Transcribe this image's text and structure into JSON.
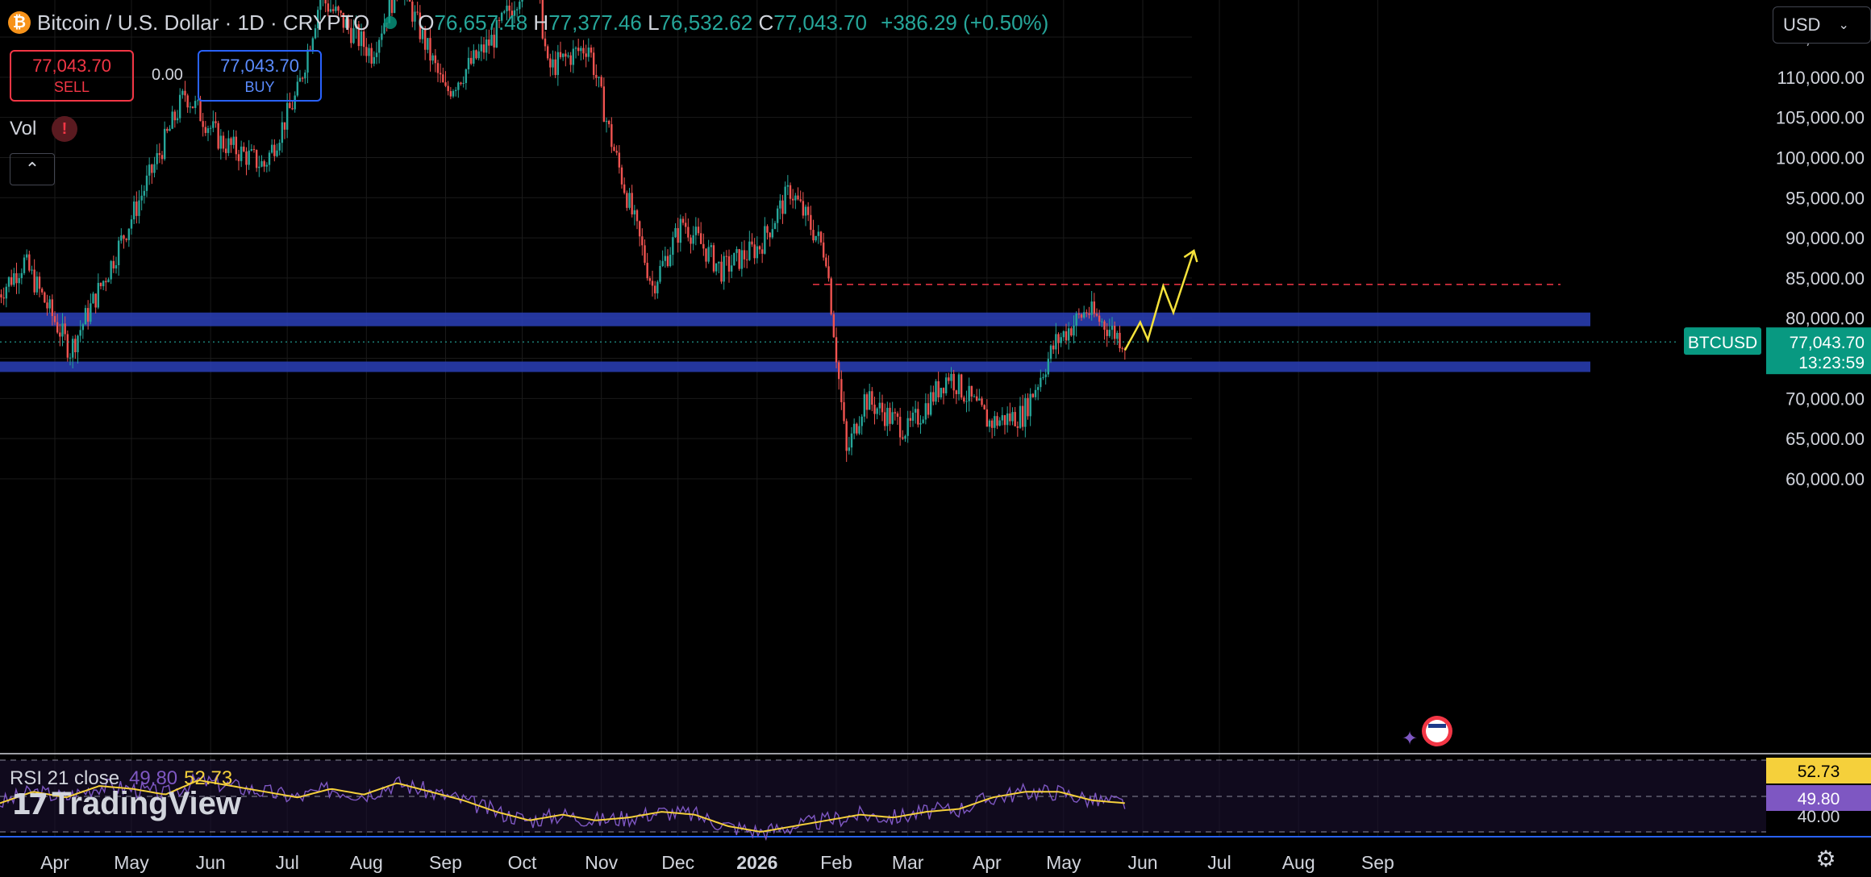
{
  "header": {
    "coin_letter": "₿",
    "symbol_title": "Bitcoin / U.S. Dollar · 1D · CRYPTO",
    "open_label": "O",
    "open_value": "76,657.48",
    "high_label": "H",
    "high_value": "77,377.46",
    "low_label": "L",
    "low_value": "76,532.62",
    "close_label": "C",
    "close_value": "77,043.70",
    "change": "+386.29 (+0.50%)"
  },
  "trade": {
    "sell_price": "77,043.70",
    "sell_label": "SELL",
    "spread": "0.00",
    "buy_price": "77,043.70",
    "buy_label": "BUY"
  },
  "indicators": {
    "vol_label": "Vol",
    "warn_glyph": "!",
    "collapse_glyph": "⌃",
    "rsi_label": "RSI 21 close",
    "rsi_value": "49.80",
    "rsi_ma_value": "52.73"
  },
  "currency_select": "USD",
  "branding": "TradingView",
  "colors": {
    "up": "#26a69a",
    "down": "#ef5350",
    "zone": "#2a3fb8",
    "projection": "#f5e23b",
    "resistance_line": "#f23645",
    "rsi": "#7e57c2",
    "rsi_ma": "#f5d03b"
  },
  "chart_data": {
    "type": "candlestick",
    "title": "Bitcoin / U.S. Dollar · 1D · CRYPTO",
    "ylim": [
      57000,
      118000
    ],
    "y_ticks": [
      60000,
      65000,
      70000,
      75000,
      80000,
      85000,
      90000,
      95000,
      100000,
      105000,
      110000,
      115000
    ],
    "y_tick_labels": [
      "60,000.00",
      "65,000.00",
      "70,000.00",
      "",
      "80,000.00",
      "85,000.00",
      "90,000.00",
      "95,000.00",
      "100,000.00",
      "105,000.00",
      "110,000.00",
      "115,000.00"
    ],
    "x_labels": [
      "Apr",
      "May",
      "Jun",
      "Jul",
      "Aug",
      "Sep",
      "Oct",
      "Nov",
      "Dec",
      "2026",
      "Feb",
      "Mar",
      "Apr",
      "May",
      "Jun",
      "Jul",
      "Aug",
      "Sep"
    ],
    "price_path": [
      {
        "date": "2025-03-10",
        "price": 83000
      },
      {
        "date": "2025-03-20",
        "price": 87000
      },
      {
        "date": "2025-04-07",
        "price": 76000
      },
      {
        "date": "2025-04-22",
        "price": 86000
      },
      {
        "date": "2025-05-10",
        "price": 99000
      },
      {
        "date": "2025-05-22",
        "price": 108000
      },
      {
        "date": "2025-06-05",
        "price": 102000
      },
      {
        "date": "2025-06-22",
        "price": 99000
      },
      {
        "date": "2025-07-05",
        "price": 108000
      },
      {
        "date": "2025-07-14",
        "price": 120000
      },
      {
        "date": "2025-08-03",
        "price": 113000
      },
      {
        "date": "2025-08-14",
        "price": 122000
      },
      {
        "date": "2025-09-01",
        "price": 108000
      },
      {
        "date": "2025-09-20",
        "price": 115000
      },
      {
        "date": "2025-10-06",
        "price": 124000
      },
      {
        "date": "2025-10-11",
        "price": 111000
      },
      {
        "date": "2025-10-27",
        "price": 114000
      },
      {
        "date": "2025-11-05",
        "price": 102000
      },
      {
        "date": "2025-11-21",
        "price": 84000
      },
      {
        "date": "2025-12-03",
        "price": 92000
      },
      {
        "date": "2025-12-18",
        "price": 86000
      },
      {
        "date": "2026-01-02",
        "price": 89000
      },
      {
        "date": "2026-01-14",
        "price": 96000
      },
      {
        "date": "2026-01-28",
        "price": 88000
      },
      {
        "date": "2026-02-05",
        "price": 63000
      },
      {
        "date": "2026-02-12",
        "price": 70000
      },
      {
        "date": "2026-03-01",
        "price": 66000
      },
      {
        "date": "2026-03-17",
        "price": 73000
      },
      {
        "date": "2026-04-02",
        "price": 67000
      },
      {
        "date": "2026-04-15",
        "price": 68000
      },
      {
        "date": "2026-04-28",
        "price": 77000
      },
      {
        "date": "2026-05-10",
        "price": 81000
      },
      {
        "date": "2026-05-18",
        "price": 79000
      },
      {
        "date": "2026-05-25",
        "price": 77000
      }
    ],
    "support_zones": [
      {
        "low": 79000,
        "high": 80700
      },
      {
        "low": 73300,
        "high": 74600
      }
    ],
    "resistance_level": 84200,
    "projection_path": [
      {
        "date": "2026-05-25",
        "price": 76000
      },
      {
        "date": "2026-05-31",
        "price": 79500
      },
      {
        "date": "2026-06-03",
        "price": 77300
      },
      {
        "date": "2026-06-09",
        "price": 84000
      },
      {
        "date": "2026-06-13",
        "price": 80700
      },
      {
        "date": "2026-06-21",
        "price": 88400
      }
    ],
    "last_price": {
      "symbol": "BTCUSD",
      "price": 77043.7,
      "price_label": "77,043.70",
      "countdown": "13:23:59"
    },
    "rsi": {
      "label": "RSI 21 close",
      "ylim": [
        36,
        58
      ],
      "tick_labels": [
        "40.00"
      ],
      "value_label": "49.80",
      "ma_label": "52.73",
      "series": [
        50,
        54,
        52,
        56,
        55,
        53,
        58,
        56,
        54,
        52,
        55,
        53,
        57,
        54,
        51,
        47,
        44,
        46,
        44,
        45,
        47,
        46,
        42,
        40,
        42,
        44,
        46,
        45,
        47,
        48,
        52,
        54,
        54,
        51,
        50
      ]
    }
  }
}
